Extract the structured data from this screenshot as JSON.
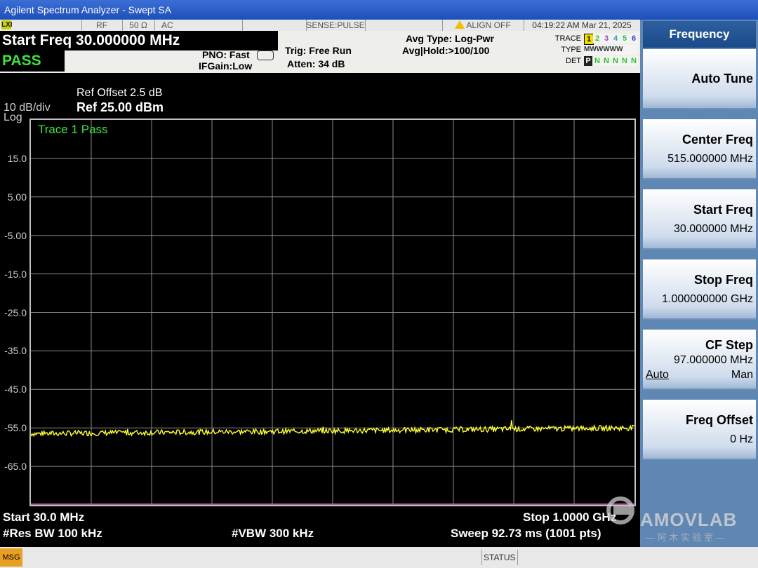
{
  "window": {
    "title": "Agilent Spectrum Analyzer - Swept SA"
  },
  "status_strip": {
    "lxi": "LXI",
    "rf": "RF",
    "impedance": "50 Ω",
    "coupling": "AC",
    "sense": "SENSE:PULSE",
    "align": "ALIGN OFF",
    "datetime": "04:19:22 AM Mar 21, 2025"
  },
  "meas": {
    "start_freq": "Start Freq 30.000000 MHz",
    "pass": "PASS",
    "pno": "PNO: Fast",
    "ifgain": "IFGain:Low",
    "trig": "Trig: Free Run",
    "atten": "Atten: 34 dB",
    "avg_type": "Avg Type: Log-Pwr",
    "avg_hold": "Avg|Hold:>100/100"
  },
  "trace_panel": {
    "trace_label": "TRACE",
    "type_label": "TYPE",
    "det_label": "DET",
    "traces": [
      "1",
      "2",
      "3",
      "4",
      "5",
      "6"
    ],
    "trace_colors": [
      "#f0e000",
      "#30c030",
      "#a040c0",
      "#30a0c0",
      "#30c060",
      "#4040d0"
    ],
    "type_row": "MWWWWW",
    "det_row": [
      "P",
      "N",
      "N",
      "N",
      "N",
      "N"
    ]
  },
  "display": {
    "ref_offset": "Ref Offset 2.5 dB",
    "ref_level": "Ref 25.00 dBm",
    "scale": "10 dB/div",
    "log": "Log",
    "trace_pass": "Trace 1 Pass"
  },
  "footer": {
    "start": "Start 30.0 MHz",
    "stop": "Stop 1.0000 GHz",
    "rbw": "#Res BW 100 kHz",
    "vbw": "#VBW 300 kHz",
    "sweep": "Sweep  92.73 ms (1001 pts)"
  },
  "softkeys": {
    "menu_title": "Frequency",
    "auto_tune": "Auto Tune",
    "center_freq_label": "Center Freq",
    "center_freq_value": "515.000000 MHz",
    "start_freq_label": "Start Freq",
    "start_freq_value": "30.000000 MHz",
    "stop_freq_label": "Stop Freq",
    "stop_freq_value": "1.000000000 GHz",
    "cf_step_label": "CF Step",
    "cf_step_value": "97.000000 MHz",
    "cf_step_auto": "Auto",
    "cf_step_man": "Man",
    "freq_offset_label": "Freq Offset",
    "freq_offset_value": "0 Hz"
  },
  "msgbar": {
    "msg": "MSG",
    "status": "STATUS"
  },
  "watermark": {
    "brand": "AMOVLAB",
    "subtitle": "— 阿 木 实 验 室 —"
  },
  "colors": {
    "trace": "#ffff33",
    "pass": "#3ce33c",
    "grid": "#8a8a8a",
    "softkey_bg": "#5e87b4"
  },
  "chart_data": {
    "type": "line",
    "title": "Trace 1 Pass",
    "xlabel": "",
    "ylabel": "",
    "x_range_hz": [
      30000000,
      1000000000
    ],
    "ylim": [
      -75,
      25
    ],
    "y_tick_labels": [
      "15.0",
      "5.00",
      "-5.00",
      "-15.0",
      "-25.0",
      "-35.0",
      "-45.0",
      "-55.0",
      "-65.0"
    ],
    "grid": true,
    "points": 1001,
    "series": [
      {
        "name": "Trace 1",
        "noise_floor_start_dbm": -56.5,
        "noise_floor_end_dbm": -55.0,
        "max_spur_dbm": -53.0
      }
    ]
  }
}
